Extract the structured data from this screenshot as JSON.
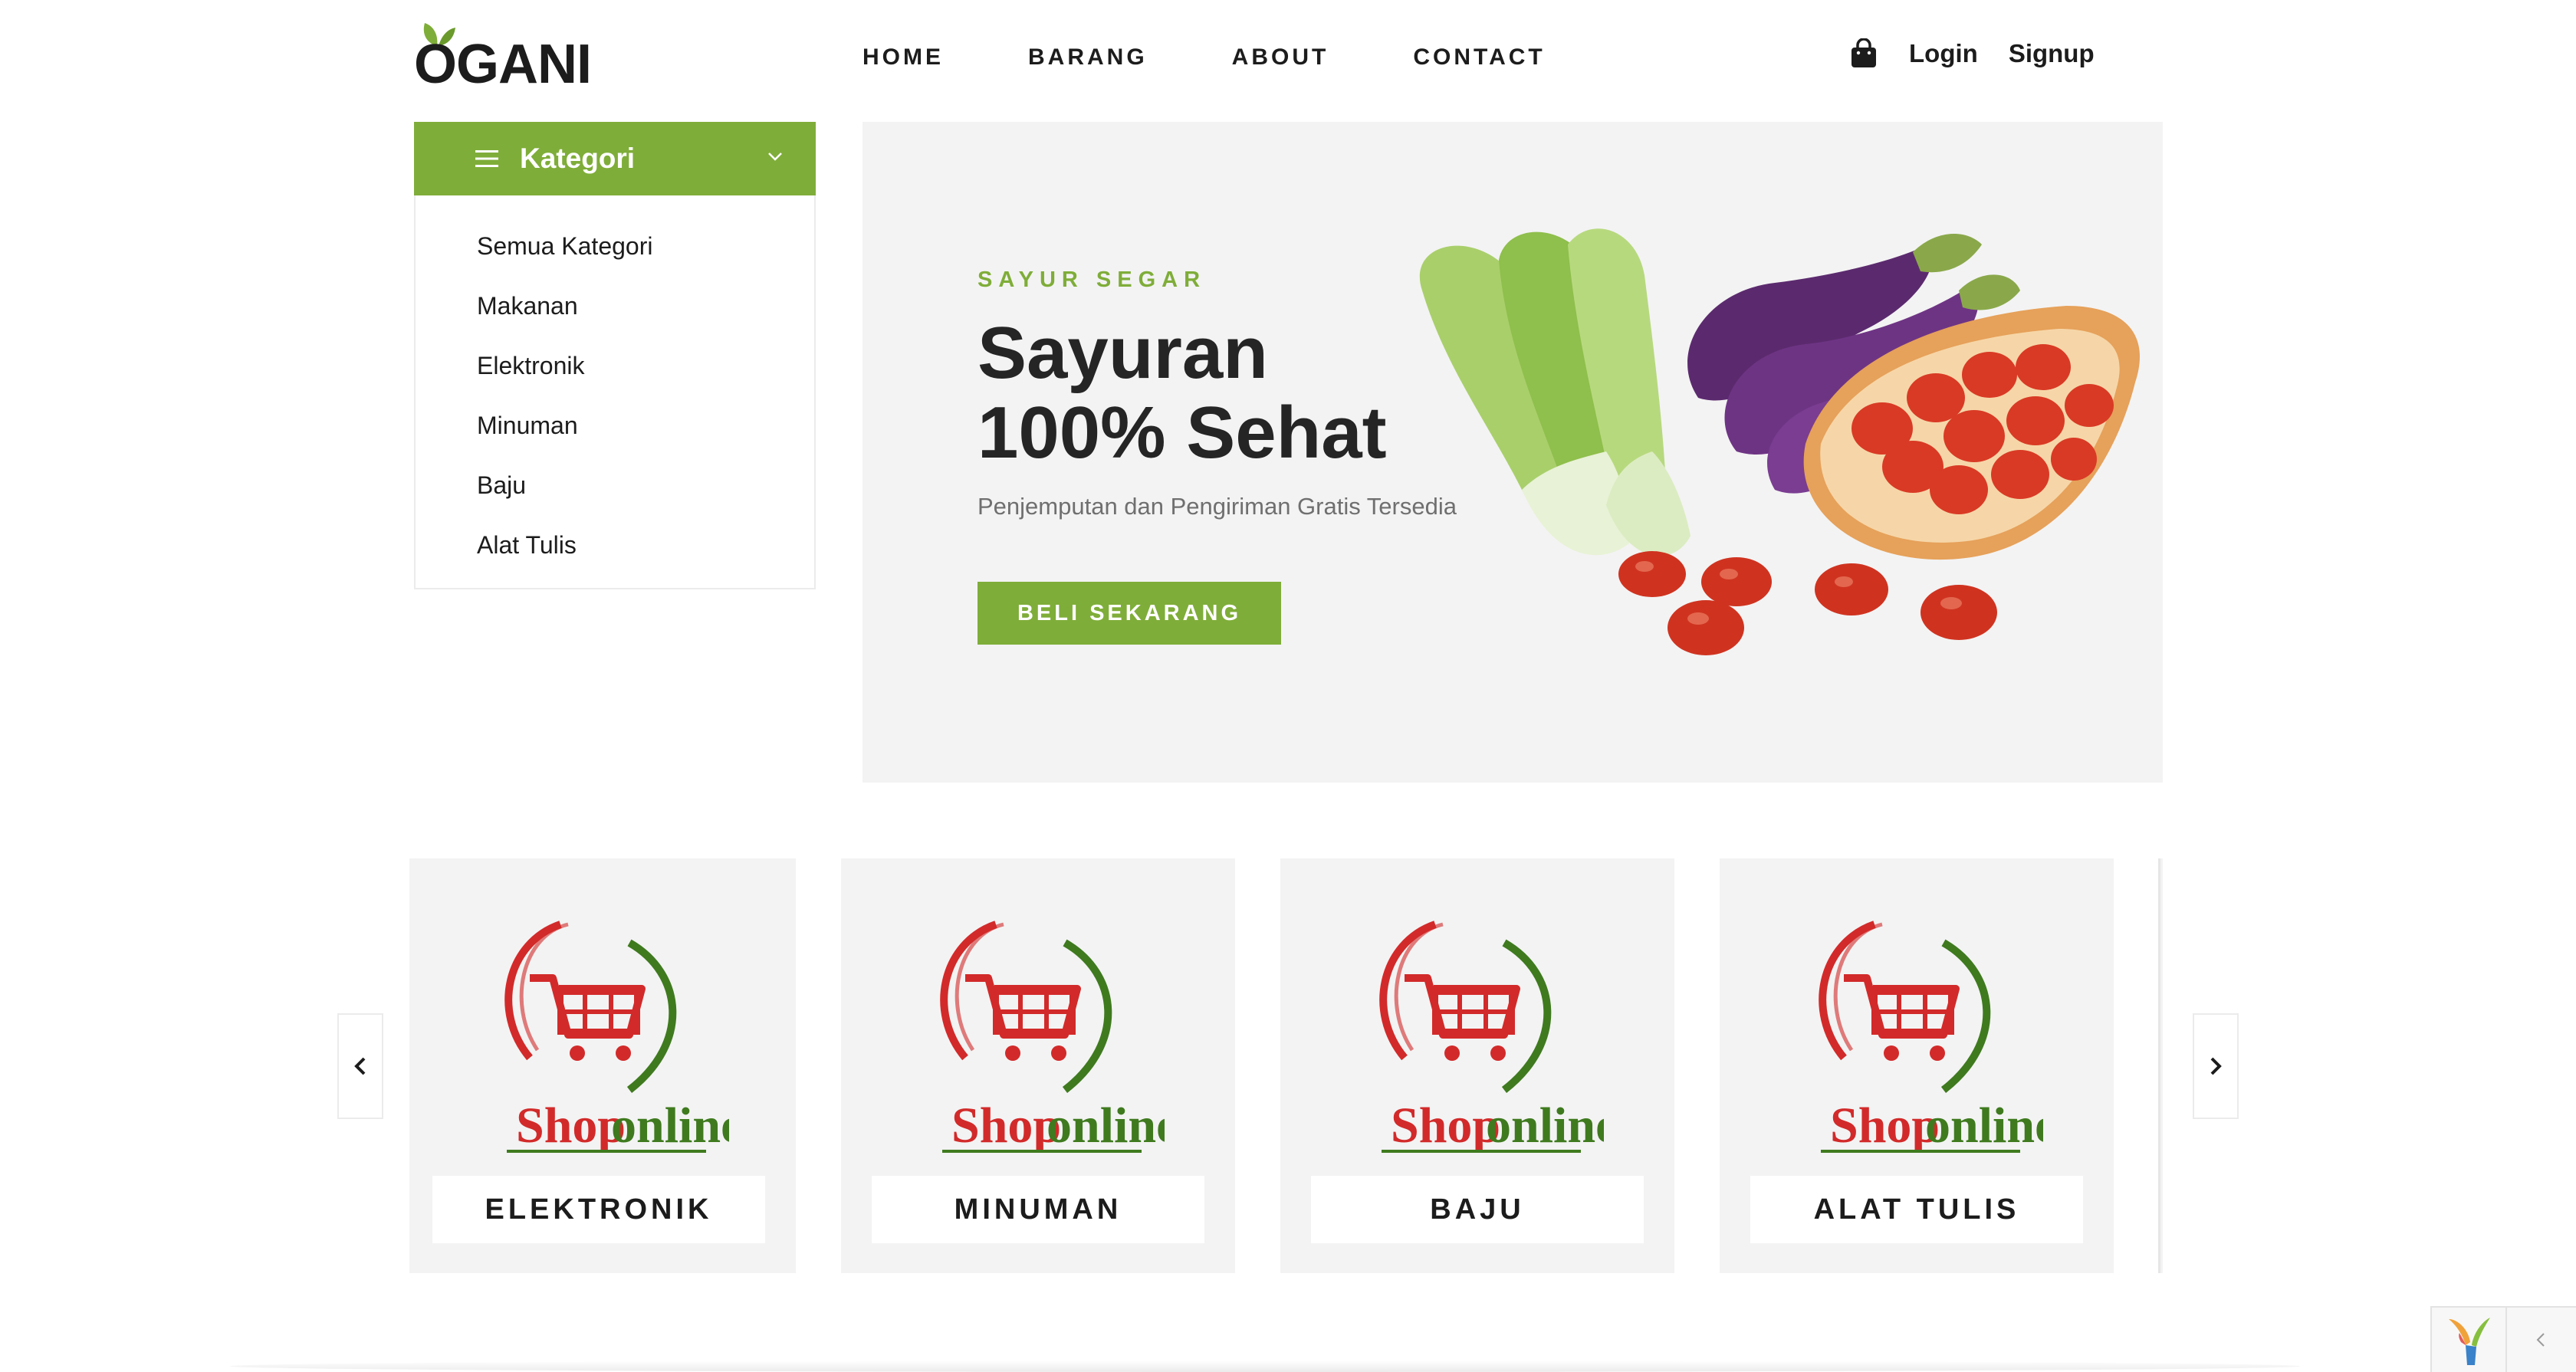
{
  "brand": {
    "name": "OGANI"
  },
  "nav": {
    "items": [
      {
        "label": "HOME"
      },
      {
        "label": "BARANG"
      },
      {
        "label": "ABOUT"
      },
      {
        "label": "CONTACT"
      }
    ]
  },
  "header_right": {
    "bag_icon": "shopping-bag-icon",
    "login": "Login",
    "signup": "Signup"
  },
  "kategori": {
    "title": "Kategori",
    "items": [
      {
        "label": "Semua Kategori"
      },
      {
        "label": "Makanan"
      },
      {
        "label": "Elektronik"
      },
      {
        "label": "Minuman"
      },
      {
        "label": "Baju"
      },
      {
        "label": "Alat Tulis"
      }
    ]
  },
  "hero": {
    "kicker": "SAYUR SEGAR",
    "title_line1": "Sayuran",
    "title_line2": "100% Sehat",
    "subtitle": "Penjemputan dan Pengiriman Gratis Tersedia",
    "button": "BELI SEKARANG"
  },
  "categories": {
    "cards": [
      {
        "label": "ELEKTRONIK",
        "logo_text_1": "Shop",
        "logo_text_2": "online"
      },
      {
        "label": "MINUMAN",
        "logo_text_1": "Shop",
        "logo_text_2": "online"
      },
      {
        "label": "BAJU",
        "logo_text_1": "Shop",
        "logo_text_2": "online"
      },
      {
        "label": "ALAT TULIS",
        "logo_text_1": "Shop",
        "logo_text_2": "online"
      }
    ]
  },
  "colors": {
    "accent_green": "#7fad39",
    "hero_bg": "#f3f3f3",
    "logo_red": "#d22a2a",
    "logo_green": "#3f7a1f"
  }
}
